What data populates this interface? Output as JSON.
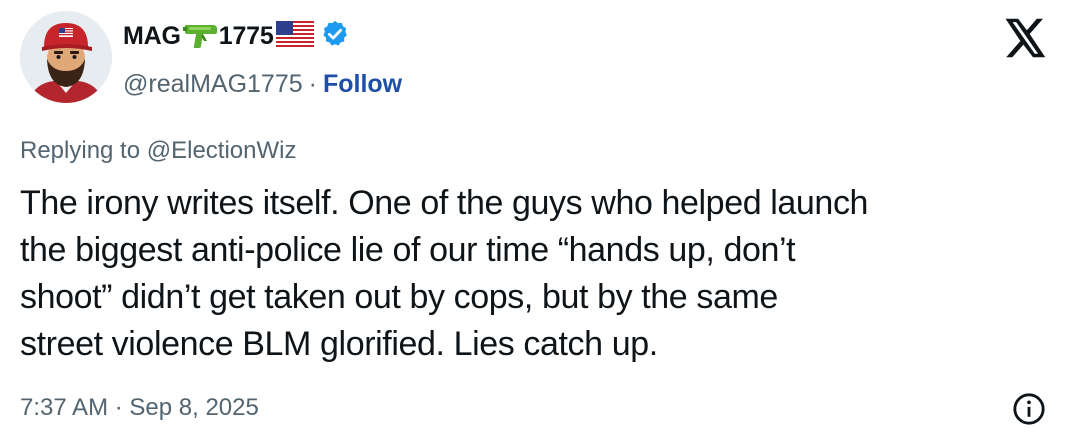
{
  "author": {
    "display_name": "MAG",
    "display_name_suffix": "1775",
    "name_icons": [
      "water-pistol-icon",
      "us-flag-icon"
    ],
    "handle": "@realMAG1775",
    "separator": "·",
    "follow_label": "Follow",
    "verified": true,
    "avatar": "avatar-illustration-red-cap-man"
  },
  "reply": {
    "prefix": "Replying to ",
    "handle": "@ElectionWiz"
  },
  "tweet": {
    "lines": [
      "The irony writes itself. One of the guys who helped launch",
      "the biggest anti-police lie of our time “hands up, don’t",
      "shoot”  didn’t get taken out by cops, but by the same",
      "street violence BLM glorified. Lies catch up."
    ]
  },
  "meta": {
    "timestamp": "7:37 AM · Sep 8, 2025"
  },
  "icons": {
    "platform_logo": "x-logo-icon",
    "info": "info-icon"
  },
  "colors": {
    "text": "#0f1419",
    "secondary": "#536471",
    "follow": "#1d4fa8",
    "verified_badge": "#1d9bf0"
  }
}
